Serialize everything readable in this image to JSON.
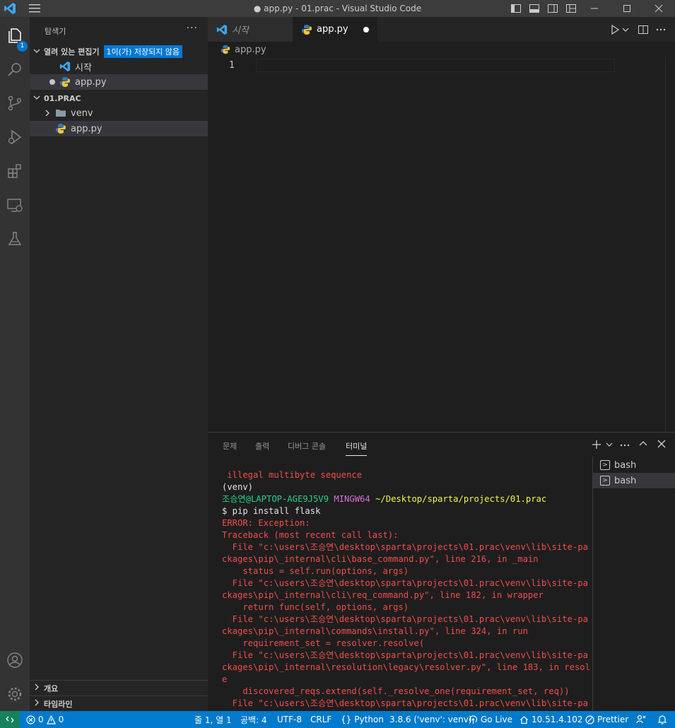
{
  "window": {
    "title": "● app.py - 01.prac - Visual Studio Code"
  },
  "sidebar": {
    "title": "탐색기",
    "more": "···",
    "open_editors": {
      "header": "열려 있는 편집기",
      "unsaved_badge": "1이(가) 저장되지 않음",
      "items": [
        {
          "label": "시작",
          "icon": "vscode-icon"
        },
        {
          "label": "app.py",
          "icon": "python-icon",
          "dirty": true
        }
      ]
    },
    "folder": {
      "header": "01.PRAC",
      "items": [
        {
          "label": "venv",
          "icon": "folder-icon"
        },
        {
          "label": "app.py",
          "icon": "python-icon"
        }
      ]
    },
    "bottom_sections": [
      "개요",
      "타임라인"
    ]
  },
  "activity_bar": {
    "explorer_badge": "1",
    "icons": [
      "explorer-icon",
      "search-icon",
      "source-control-icon",
      "run-debug-icon",
      "extensions-icon",
      "remote-explorer-icon",
      "testing-icon",
      "account-icon",
      "settings-gear-icon"
    ]
  },
  "editor": {
    "tabs": [
      {
        "label": "시작",
        "active": false
      },
      {
        "label": "app.py",
        "active": true,
        "dirty": true
      }
    ],
    "breadcrumb": "app.py",
    "line_numbers": [
      "1"
    ]
  },
  "panel": {
    "tabs": [
      "문제",
      "출력",
      "디버그 콘솔",
      "터미널"
    ],
    "active_tab": "터미널",
    "terminals": [
      "bash",
      "bash"
    ],
    "terminal_lines": [
      [
        {
          "t": " illegal multibyte sequence",
          "c": "red"
        }
      ],
      [
        {
          "t": "(venv)",
          "c": "white"
        }
      ],
      [
        {
          "t": "조승연@LAPTOP-AGE9J5V9 ",
          "c": "green"
        },
        {
          "t": "MINGW64 ",
          "c": "magenta"
        },
        {
          "t": "~/Desktop/sparta/projects/01.prac",
          "c": "yellow"
        }
      ],
      [
        {
          "t": "$ pip install flask",
          "c": "white"
        }
      ],
      [
        {
          "t": "ERROR: Exception:",
          "c": "red"
        }
      ],
      [
        {
          "t": "Traceback (most recent call last):",
          "c": "red"
        }
      ],
      [
        {
          "t": "  File \"c:\\users\\조승연\\desktop\\sparta\\projects\\01.prac\\venv\\lib\\site-pa",
          "c": "red"
        }
      ],
      [
        {
          "t": "ckages\\pip\\_internal\\cli\\base_command.py\", line 216, in _main",
          "c": "red"
        }
      ],
      [
        {
          "t": "    status = self.run(options, args)",
          "c": "red"
        }
      ],
      [
        {
          "t": "  File \"c:\\users\\조승연\\desktop\\sparta\\projects\\01.prac\\venv\\lib\\site-pa",
          "c": "red"
        }
      ],
      [
        {
          "t": "ckages\\pip\\_internal\\cli\\req_command.py\", line 182, in wrapper",
          "c": "red"
        }
      ],
      [
        {
          "t": "    return func(self, options, args)",
          "c": "red"
        }
      ],
      [
        {
          "t": "  File \"c:\\users\\조승연\\desktop\\sparta\\projects\\01.prac\\venv\\lib\\site-pa",
          "c": "red"
        }
      ],
      [
        {
          "t": "ckages\\pip\\_internal\\commands\\install.py\", line 324, in run",
          "c": "red"
        }
      ],
      [
        {
          "t": "    requirement_set = resolver.resolve(",
          "c": "red"
        }
      ],
      [
        {
          "t": "  File \"c:\\users\\조승연\\desktop\\sparta\\projects\\01.prac\\venv\\lib\\site-pa",
          "c": "red"
        }
      ],
      [
        {
          "t": "ckages\\pip\\_internal\\resolution\\legacy\\resolver.py\", line 183, in resolv",
          "c": "red"
        }
      ],
      [
        {
          "t": "e",
          "c": "red"
        }
      ],
      [
        {
          "t": "    discovered_reqs.extend(self._resolve_one(requirement_set, req))",
          "c": "red"
        }
      ],
      [
        {
          "t": "  File \"c:\\users\\조승연\\desktop\\sparta\\projects\\01.prac\\venv\\lib\\site-pa",
          "c": "red"
        }
      ]
    ]
  },
  "statusbar": {
    "errors": "0",
    "warnings": "0",
    "position": "줄 1, 열 1",
    "spaces": "공백: 4",
    "encoding": "UTF-8",
    "eol": "CRLF",
    "language": "Python",
    "interpreter": "3.8.6 ('venv': venv)",
    "go_live": "Go Live",
    "ip": "10.51.4.102",
    "prettier": "Prettier"
  },
  "colors": {
    "accent": "#007acc",
    "badge": "#0078d4",
    "terminal_error": "#f14c4c"
  }
}
